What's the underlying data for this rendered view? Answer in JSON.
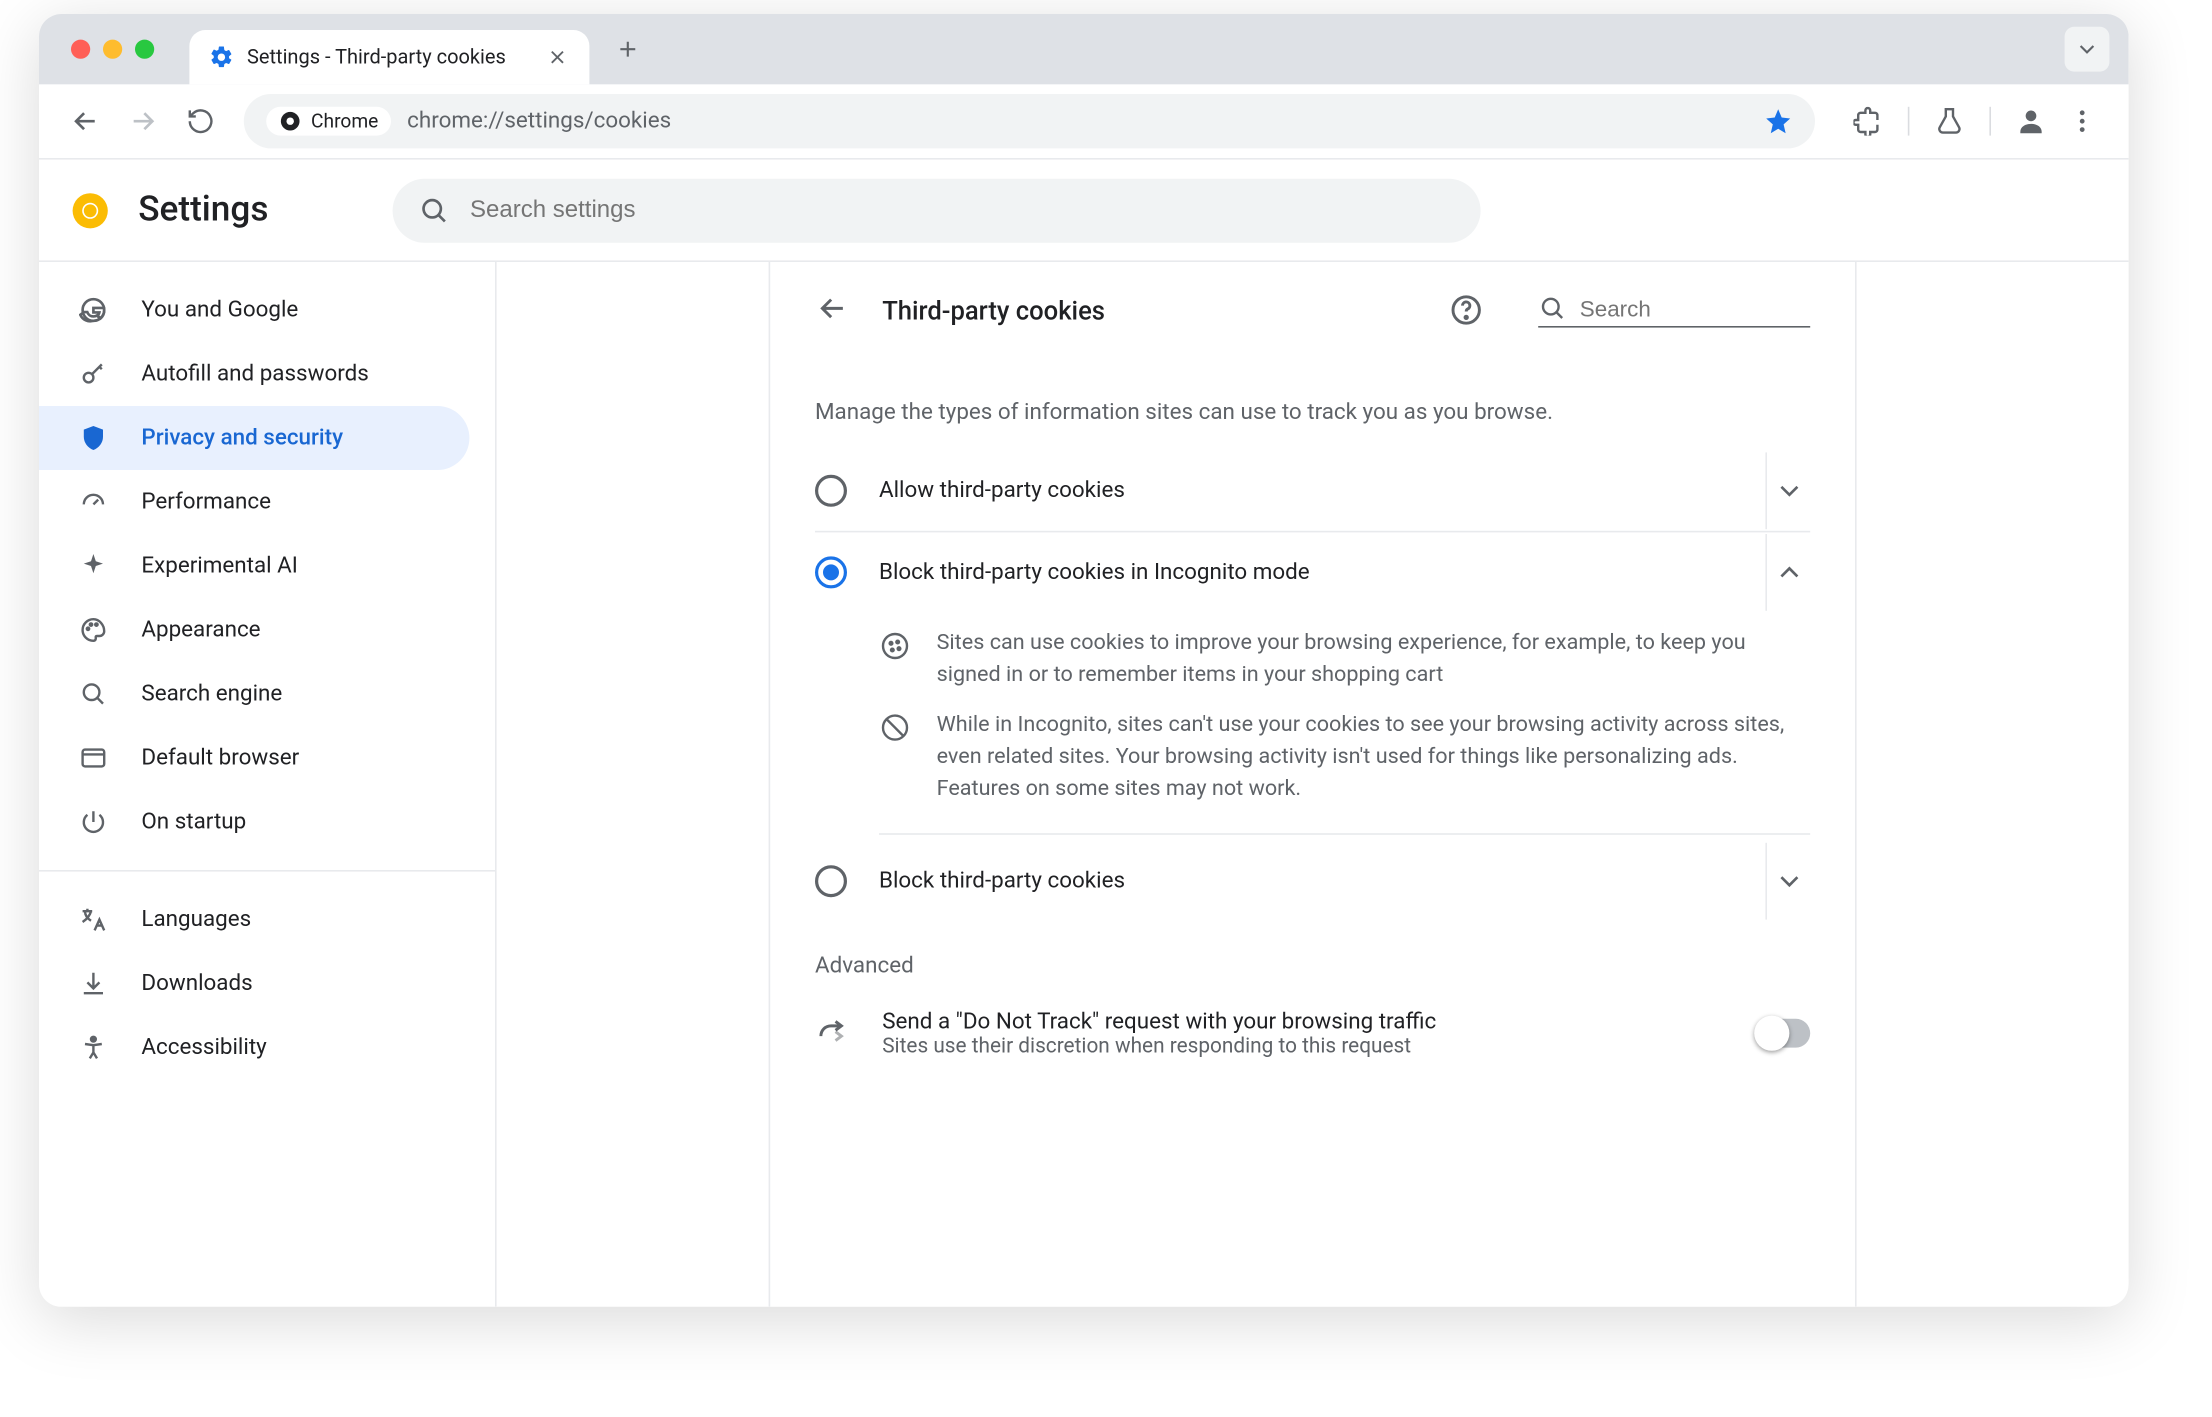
{
  "window": {
    "tab_title": "Settings - Third-party cookies",
    "url_chip": "Chrome",
    "url": "chrome://settings/cookies"
  },
  "header": {
    "title": "Settings",
    "search_placeholder": "Search settings"
  },
  "sidebar": {
    "items": [
      {
        "label": "You and Google"
      },
      {
        "label": "Autofill and passwords"
      },
      {
        "label": "Privacy and security"
      },
      {
        "label": "Performance"
      },
      {
        "label": "Experimental AI"
      },
      {
        "label": "Appearance"
      },
      {
        "label": "Search engine"
      },
      {
        "label": "Default browser"
      },
      {
        "label": "On startup"
      }
    ],
    "items2": [
      {
        "label": "Languages"
      },
      {
        "label": "Downloads"
      },
      {
        "label": "Accessibility"
      }
    ]
  },
  "page": {
    "title": "Third-party cookies",
    "search_placeholder": "Search",
    "description": "Manage the types of information sites can use to track you as you browse.",
    "options": [
      {
        "label": "Allow third-party cookies"
      },
      {
        "label": "Block third-party cookies in Incognito mode"
      },
      {
        "label": "Block third-party cookies"
      }
    ],
    "detail": {
      "line1": "Sites can use cookies to improve your browsing experience, for example, to keep you signed in or to remember items in your shopping cart",
      "line2": "While in Incognito, sites can't use your cookies to see your browsing activity across sites, even related sites. Your browsing activity isn't used for things like personalizing ads. Features on some sites may not work."
    },
    "advanced_label": "Advanced",
    "dnt": {
      "title": "Send a \"Do Not Track\" request with your browsing traffic",
      "sub": "Sites use their discretion when responding to this request"
    }
  }
}
